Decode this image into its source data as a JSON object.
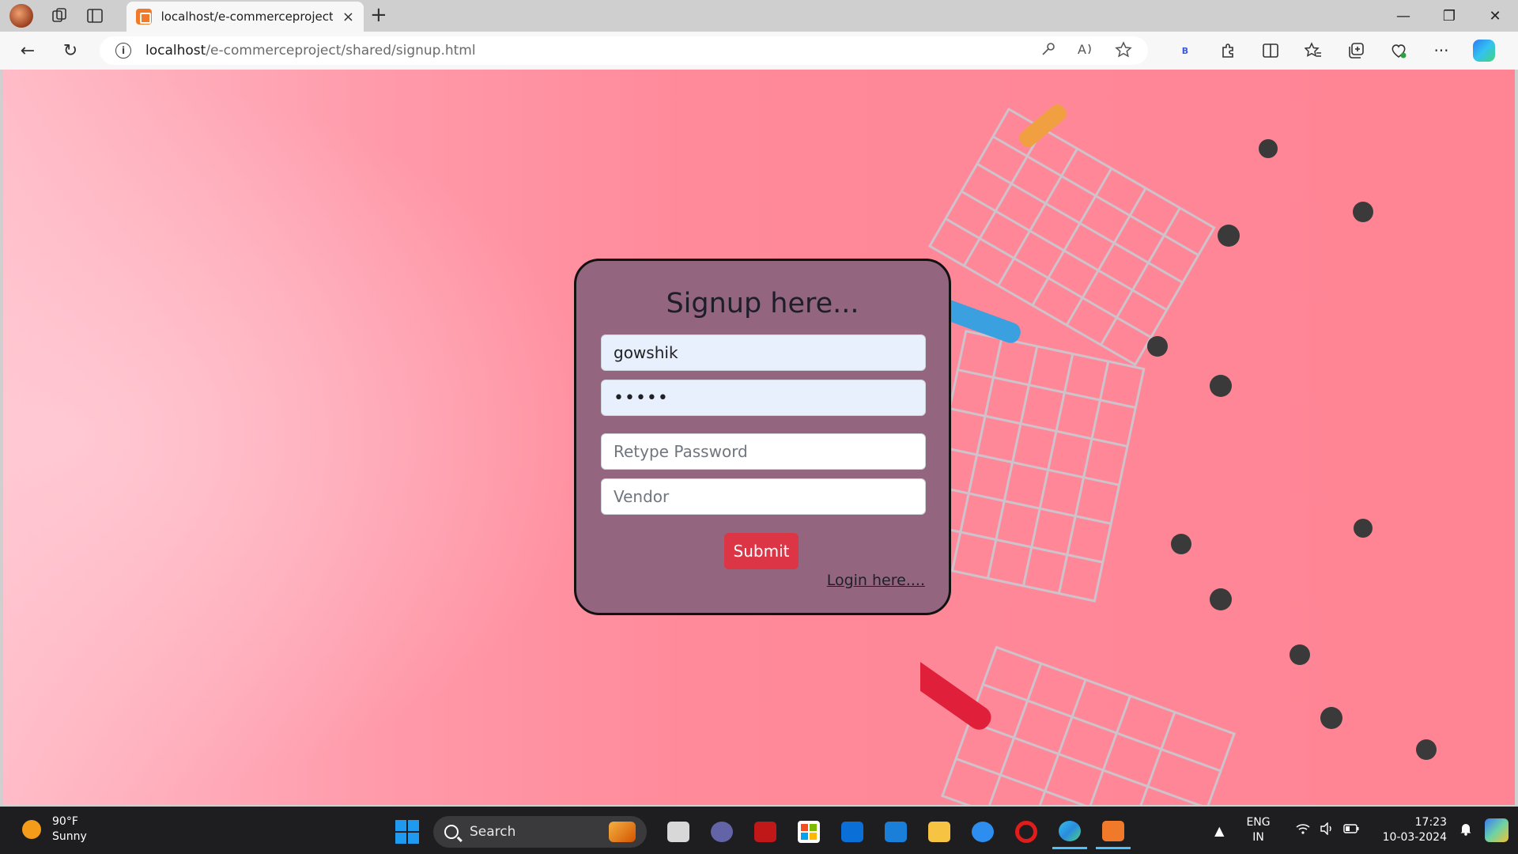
{
  "browser": {
    "tab_title": "localhost/e-commerceproject/shared/signup.html",
    "tab_close_glyph": "×",
    "new_tab_glyph": "+",
    "url_host": "localhost",
    "url_path": "/e-commerceproject/shared/signup.html",
    "window_controls": {
      "minimize": "—",
      "restore": "❐",
      "close": "✕"
    },
    "nav": {
      "back": "←",
      "refresh": "↻"
    },
    "extension_badge": "B",
    "more_glyph": "···"
  },
  "signup": {
    "heading": "Signup here...",
    "username_value": "gowshik",
    "password_mask": "•••••",
    "retype_placeholder": "Retype Password",
    "role_value": "Vendor",
    "submit_label": "Submit",
    "login_link": "Login here...."
  },
  "taskbar": {
    "temperature": "90°F",
    "condition": "Sunny",
    "search_label": "Search",
    "lang_primary": "ENG",
    "lang_secondary": "IN",
    "time": "17:23",
    "date": "10-03-2024"
  },
  "colors": {
    "card_bg": "#93657e",
    "submit_bg": "#dc3545",
    "page_bg": "#ff8797",
    "autofill_bg": "#e8f0fe"
  },
  "icons": [
    "profile-avatar-icon",
    "workspaces-icon",
    "tab-actions-icon",
    "xampp-favicon-icon",
    "back-arrow-icon",
    "refresh-icon",
    "site-info-icon",
    "password-key-icon",
    "read-aloud-icon",
    "favorite-star-icon",
    "extensions-icon",
    "split-screen-icon",
    "favorites-icon",
    "collections-icon",
    "browser-essentials-icon",
    "more-menu-icon",
    "copilot-icon",
    "windows-start-icon",
    "search-icon",
    "task-view-icon",
    "teams-icon",
    "mcafee-icon",
    "store-icon",
    "myhp-icon",
    "whiteboard-icon",
    "file-explorer-icon",
    "help-icon",
    "opera-icon",
    "edge-icon",
    "xampp-icon",
    "wifi-icon",
    "volume-icon",
    "battery-icon",
    "notification-bell-icon"
  ]
}
